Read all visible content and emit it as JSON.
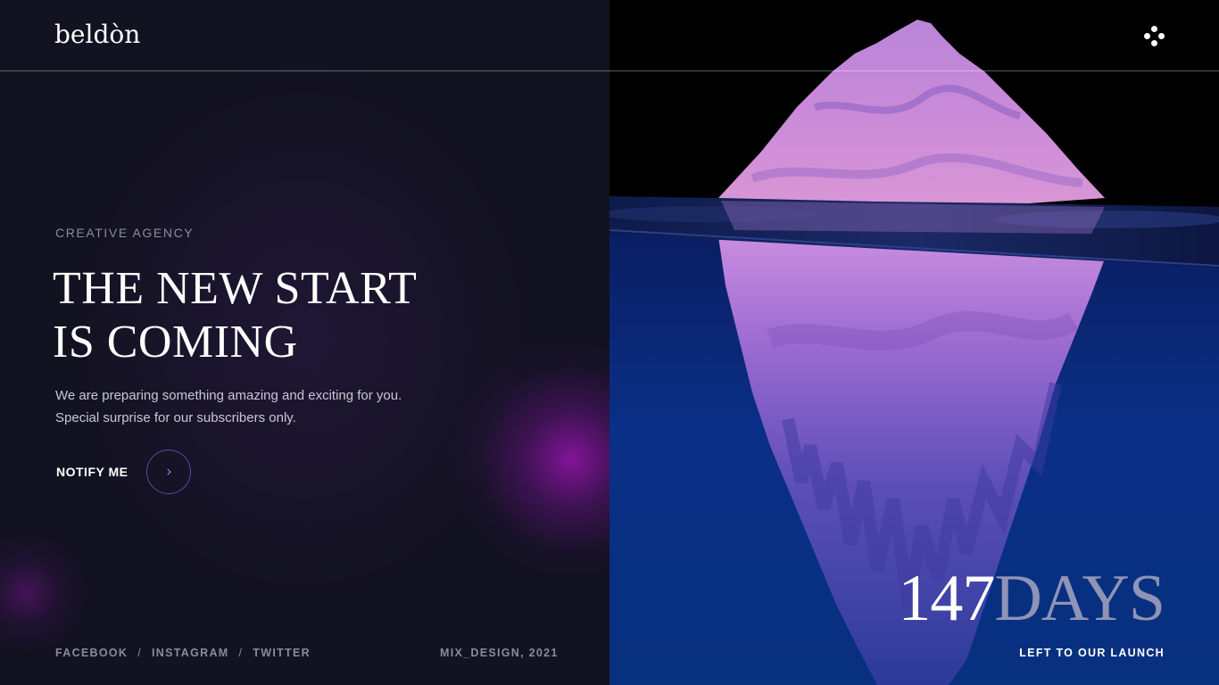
{
  "brand": {
    "logo_text": "beldòn"
  },
  "header": {
    "menu_icon": "four-dot-menu-icon"
  },
  "hero": {
    "eyebrow": "CREATIVE AGENCY",
    "headline_line1": "THE NEW START",
    "headline_line2": "IS COMING",
    "description_line1": "We are preparing something amazing and exciting for you.",
    "description_line2": "Special surprise for our subscribers only.",
    "cta_label": "NOTIFY ME",
    "cta_icon": "chevron-right-icon",
    "cta_glyph": "›"
  },
  "footer": {
    "social_links": [
      {
        "label": "FACEBOOK"
      },
      {
        "label": "INSTAGRAM"
      },
      {
        "label": "TWITTER"
      }
    ],
    "separator": "/",
    "credit": "MIX_DESIGN, 2021"
  },
  "countdown": {
    "value": "147",
    "unit": "DAYS",
    "caption": "LEFT TO OUR LAUNCH"
  },
  "colors": {
    "background": "#121220",
    "accent_purple": "#8f7ce0",
    "ocean_blue": "#0a2f86",
    "iceberg_pink": "#c77fd6"
  }
}
